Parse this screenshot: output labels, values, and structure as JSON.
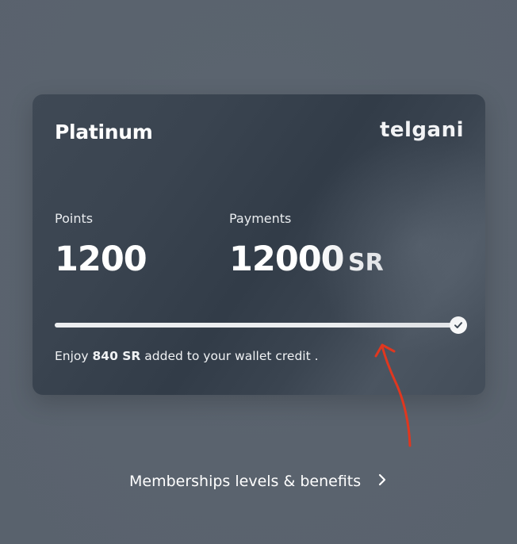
{
  "card": {
    "tier": "Platinum",
    "brand": "telgani",
    "points_label": "Points",
    "points_value": "1200",
    "payments_label": "Payments",
    "payments_value": "12000",
    "currency": "SR",
    "progress_fraction": 1.0,
    "caption_prefix": "Enjoy ",
    "caption_amount": "840 SR",
    "caption_suffix": " added to your wallet credit ."
  },
  "memberships_link": {
    "label": "Memberships levels & benefits",
    "icon": "chevron-right-icon"
  },
  "annotation": {
    "color": "#e0371f"
  },
  "colors": {
    "background": "#5a636e",
    "card": "#3a4450",
    "progress": "#eceef0"
  }
}
